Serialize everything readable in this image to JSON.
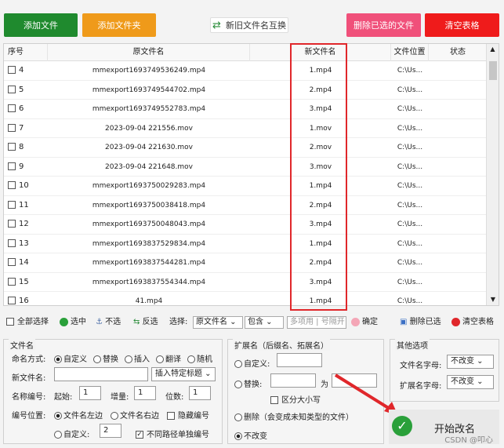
{
  "buttons": {
    "add_file": "添加文件",
    "add_folder": "添加文件夹",
    "swap": "新旧文件名互换",
    "delete_selected": "删除已选的文件",
    "clear_table": "清空表格"
  },
  "table": {
    "headers": [
      "序号",
      "原文件名",
      "新文件名",
      "文件位置",
      "状态"
    ],
    "rows": [
      {
        "idx": "4",
        "orig": "mmexport1693749536249.mp4",
        "new": "1.mp4",
        "loc": "C:\\Us..."
      },
      {
        "idx": "5",
        "orig": "mmexport1693749544702.mp4",
        "new": "2.mp4",
        "loc": "C:\\Us..."
      },
      {
        "idx": "6",
        "orig": "mmexport1693749552783.mp4",
        "new": "3.mp4",
        "loc": "C:\\Us..."
      },
      {
        "idx": "7",
        "orig": "2023-09-04 221556.mov",
        "new": "1.mov",
        "loc": "C:\\Us..."
      },
      {
        "idx": "8",
        "orig": "2023-09-04 221630.mov",
        "new": "2.mov",
        "loc": "C:\\Us..."
      },
      {
        "idx": "9",
        "orig": "2023-09-04 221648.mov",
        "new": "3.mov",
        "loc": "C:\\Us..."
      },
      {
        "idx": "10",
        "orig": "mmexport1693750029283.mp4",
        "new": "1.mp4",
        "loc": "C:\\Us..."
      },
      {
        "idx": "11",
        "orig": "mmexport1693750038418.mp4",
        "new": "2.mp4",
        "loc": "C:\\Us..."
      },
      {
        "idx": "12",
        "orig": "mmexport1693750048043.mp4",
        "new": "3.mp4",
        "loc": "C:\\Us..."
      },
      {
        "idx": "13",
        "orig": "mmexport1693837529834.mp4",
        "new": "1.mp4",
        "loc": "C:\\Us..."
      },
      {
        "idx": "14",
        "orig": "mmexport1693837544281.mp4",
        "new": "2.mp4",
        "loc": "C:\\Us..."
      },
      {
        "idx": "15",
        "orig": "mmexport1693837554344.mp4",
        "new": "3.mp4",
        "loc": "C:\\Us..."
      },
      {
        "idx": "16",
        "orig": "41.mp4",
        "new": "1.mp4",
        "loc": "C:\\Us..."
      }
    ]
  },
  "toolbar": {
    "select_all": "全部选择",
    "select": "选中",
    "deselect": "不选",
    "invert": "反选",
    "choose_label": "选择:",
    "choose_value": "原文件名",
    "match_value": "包含",
    "filter_placeholder": "多项用 | 号隔开",
    "confirm": "确定",
    "delete_selected": "删除已选",
    "clear_table": "清空表格"
  },
  "filename": {
    "title": "文件名",
    "naming_label": "命名方式:",
    "opt_custom": "自定义",
    "opt_replace": "替换",
    "opt_insert": "插入",
    "opt_translate": "翻译",
    "opt_random": "随机",
    "new_name_label": "新文件名:",
    "insert_title": "插入特定标题",
    "numbering_label": "名称编号:",
    "start_label": "起始:",
    "start_val": "1",
    "step_label": "增量:",
    "step_val": "1",
    "digits_label": "位数:",
    "digits_val": "1",
    "position_label": "编号位置:",
    "pos_left": "文件名左边",
    "pos_right": "文件名右边",
    "hide_num": "隐藏编号",
    "pos_custom": "自定义:",
    "pos_custom_val": "2",
    "sep_paths": "不同路径单独编号"
  },
  "extension": {
    "title": "扩展名（后缀名、拓展名）",
    "custom": "自定义:",
    "replace": "替换:",
    "to": "为",
    "case": "区分大小写",
    "delete": "删除（会变成未知类型的文件）",
    "nochange": "不改变"
  },
  "other": {
    "title": "其他选项",
    "fname_case": "文件名字母:",
    "fname_case_val": "不改变",
    "ext_case": "扩展名字母:",
    "ext_case_val": "不改变"
  },
  "start": {
    "label": "开始改名"
  },
  "watermark": "CSDN @叩心"
}
